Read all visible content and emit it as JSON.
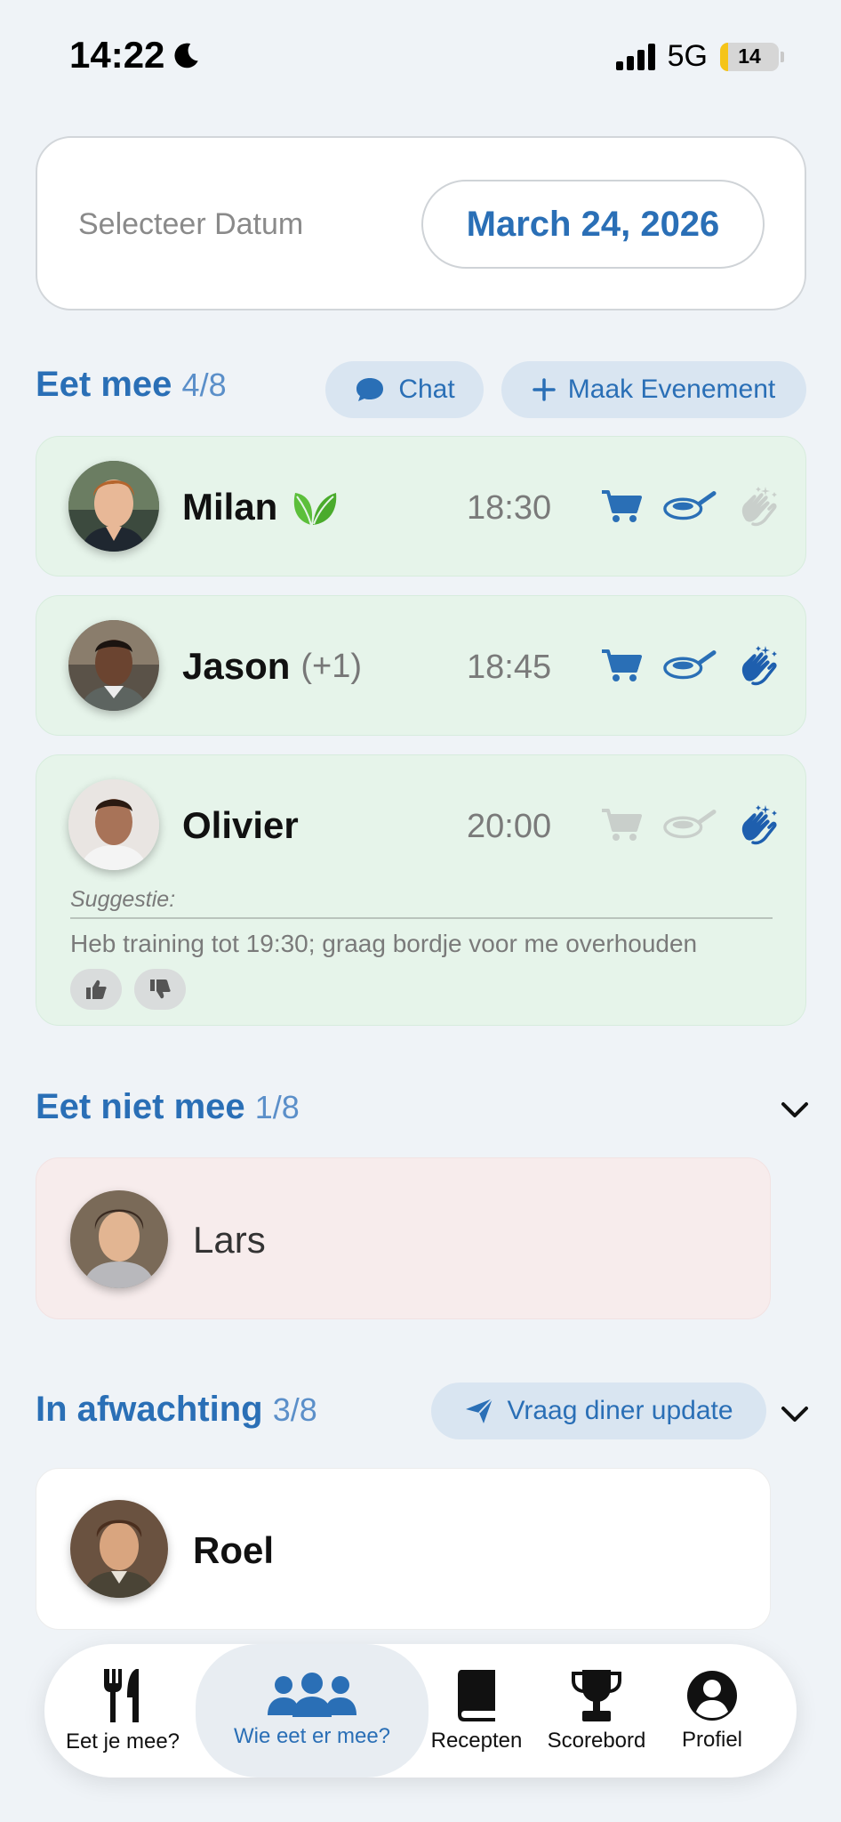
{
  "status_bar": {
    "time": "14:22",
    "network": "5G",
    "battery": "14"
  },
  "date_picker": {
    "label": "Selecteer Datum",
    "value": "March 24, 2026"
  },
  "eating": {
    "title": "Eet mee",
    "count": "4/8",
    "chat_label": "Chat",
    "create_event_label": "Maak Evenement",
    "people": [
      {
        "name": "Milan",
        "extra": "",
        "time": "18:30",
        "diet_icon": "leaf-icon",
        "tasks": {
          "shopping": true,
          "cooking": true,
          "dishes": false
        }
      },
      {
        "name": "Jason",
        "extra": "(+1)",
        "time": "18:45",
        "tasks": {
          "shopping": true,
          "cooking": true,
          "dishes": true
        }
      },
      {
        "name": "Olivier",
        "extra": "",
        "time": "20:00",
        "tasks": {
          "shopping": false,
          "cooking": false,
          "dishes": true
        },
        "suggestion_label": "Suggestie:",
        "suggestion_text": "Heb training tot 19:30; graag bordje voor me overhouden"
      }
    ]
  },
  "not_eating": {
    "title": "Eet niet mee",
    "count": "1/8",
    "people": [
      {
        "name": "Lars"
      }
    ]
  },
  "pending": {
    "title": "In afwachting",
    "count": "3/8",
    "request_label": "Vraag diner update",
    "people": [
      {
        "name": "Roel"
      }
    ]
  },
  "bottom_nav": {
    "items": [
      {
        "label": "Eet je mee?",
        "icon": "fork-knife-icon"
      },
      {
        "label": "Wie eet er mee?",
        "icon": "people-icon",
        "active": true
      },
      {
        "label": "Recepten",
        "icon": "book-icon"
      },
      {
        "label": "Scorebord",
        "icon": "trophy-icon"
      },
      {
        "label": "Profiel",
        "icon": "profile-icon"
      }
    ]
  },
  "colors": {
    "accent": "#2a6fb6",
    "background": "#eff3f7",
    "eating_card": "#e6f4ea",
    "not_eating_card": "#f7ecec",
    "leaf": "#5cbf3b"
  }
}
